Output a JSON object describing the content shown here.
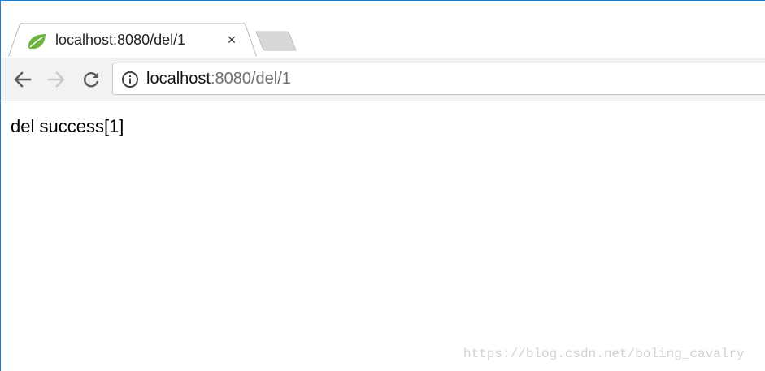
{
  "browser": {
    "tab": {
      "title": "localhost:8080/del/1",
      "favicon": "spring-leaf-icon",
      "close_label": "×"
    },
    "new_tab_icon": "new-tab-icon",
    "nav": {
      "back_icon": "back-arrow-icon",
      "forward_icon": "forward-arrow-icon",
      "reload_icon": "reload-icon"
    },
    "address_bar": {
      "info_icon": "info-icon",
      "url_host": "localhost",
      "url_rest": ":8080/del/1"
    }
  },
  "page": {
    "body_text": "del success[1]"
  },
  "watermark": "https://blog.csdn.net/boling_cavalry",
  "colors": {
    "window_border": "#1e7fd0",
    "toolbar_bg": "#f2f2f2",
    "favicon_green": "#6db33f"
  }
}
